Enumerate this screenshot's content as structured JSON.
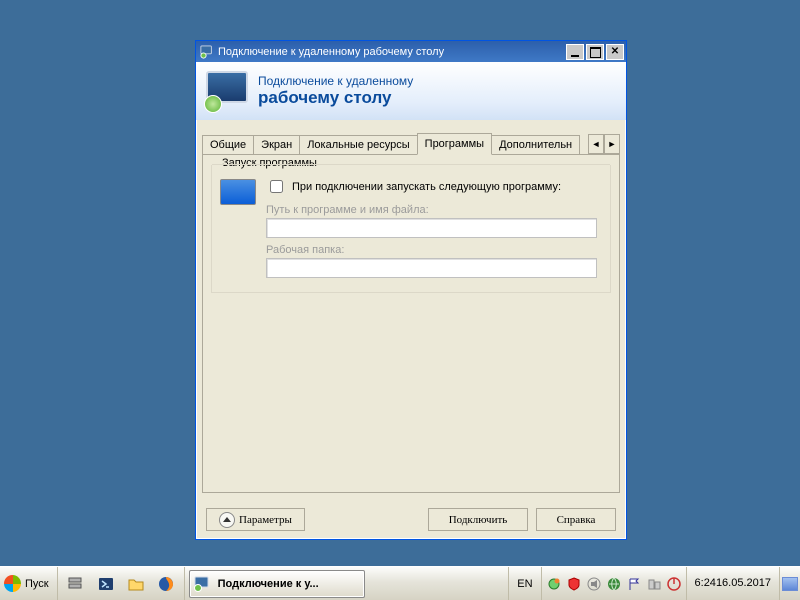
{
  "window": {
    "title": "Подключение к удаленному рабочему столу"
  },
  "banner": {
    "line1": "Подключение к удаленному",
    "line2": "рабочему столу"
  },
  "tabs": {
    "items": [
      "Общие",
      "Экран",
      "Локальные ресурсы",
      "Программы",
      "Дополнительн"
    ],
    "active_index": 3
  },
  "programs_tab": {
    "group_caption": "Запуск программы",
    "checkbox_label": "При подключении запускать следующую программу:",
    "checkbox_checked": false,
    "path_label": "Путь к программе и имя файла:",
    "path_value": "",
    "folder_label": "Рабочая папка:",
    "folder_value": ""
  },
  "buttons": {
    "options": "Параметры",
    "connect": "Подключить",
    "help": "Справка"
  },
  "taskbar": {
    "start": "Пуск",
    "task_title": "Подключение к у...",
    "lang": "EN",
    "clock_time": "6:24",
    "clock_date": "16.05.2017"
  }
}
